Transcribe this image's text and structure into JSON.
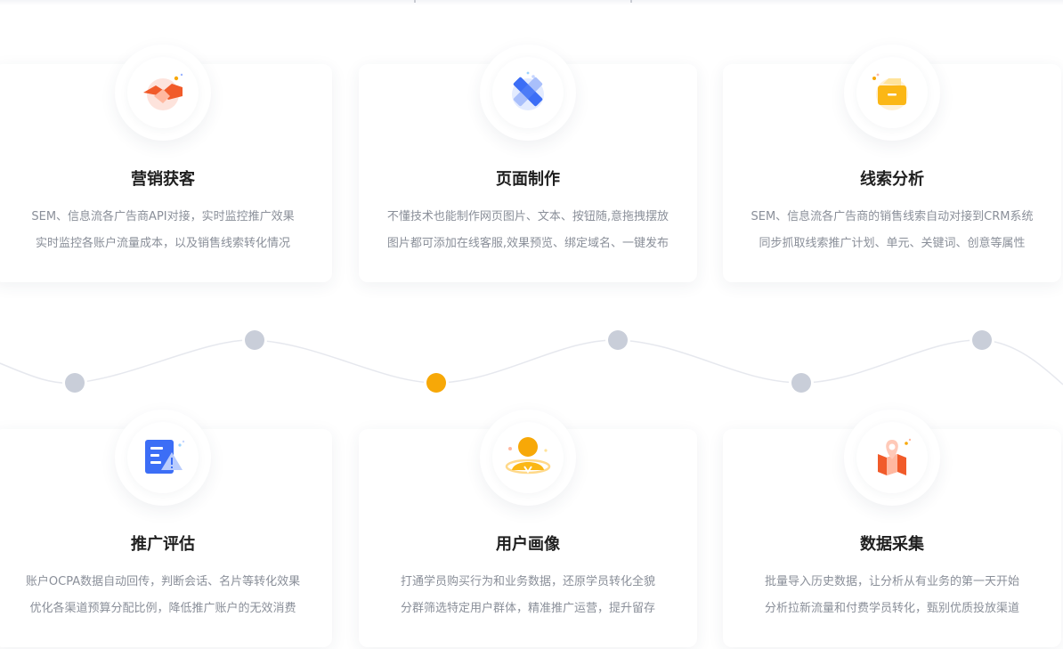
{
  "features": [
    {
      "title": "营销获客",
      "icon": "handshake-icon",
      "lines": [
        "SEM、信息流各广告商API对接，实时监控推广效果",
        "实时监控各账户流量成本，以及销售线索转化情况"
      ]
    },
    {
      "title": "页面制作",
      "icon": "pencil-ruler-icon",
      "lines": [
        "不懂技术也能制作网页图片、文本、按钮随,意拖拽摆放",
        "图片都可添加在线客服,效果预览、绑定域名、一键发布"
      ]
    },
    {
      "title": "线索分析",
      "icon": "inbox-folder-icon",
      "lines": [
        "SEM、信息流各广告商的销售线索自动对接到CRM系统",
        "同步抓取线索推广计划、单元、关键词、创意等属性"
      ]
    },
    {
      "title": "推广评估",
      "icon": "document-warning-icon",
      "lines": [
        "账户OCPA数据自动回传，判断会话、名片等转化效果",
        "优化各渠道预算分配比例，降低推广账户的无效消费"
      ]
    },
    {
      "title": "用户画像",
      "icon": "user-profile-icon",
      "lines": [
        "打通学员购买行为和业务数据，还原学员转化全貌",
        "分群筛选特定用户群体，精准推广运营，提升留存"
      ]
    },
    {
      "title": "数据采集",
      "icon": "map-pin-icon",
      "lines": [
        "批量导入历史数据，让分析从有业务的第一天开始",
        "分析拉新流量和付费学员转化，甄别优质投放渠道"
      ]
    }
  ],
  "timeline": {
    "active_index": 3,
    "colors": {
      "active": "#f7a807",
      "inactive": "#c9ced9",
      "line": "#e6e8ee"
    }
  }
}
